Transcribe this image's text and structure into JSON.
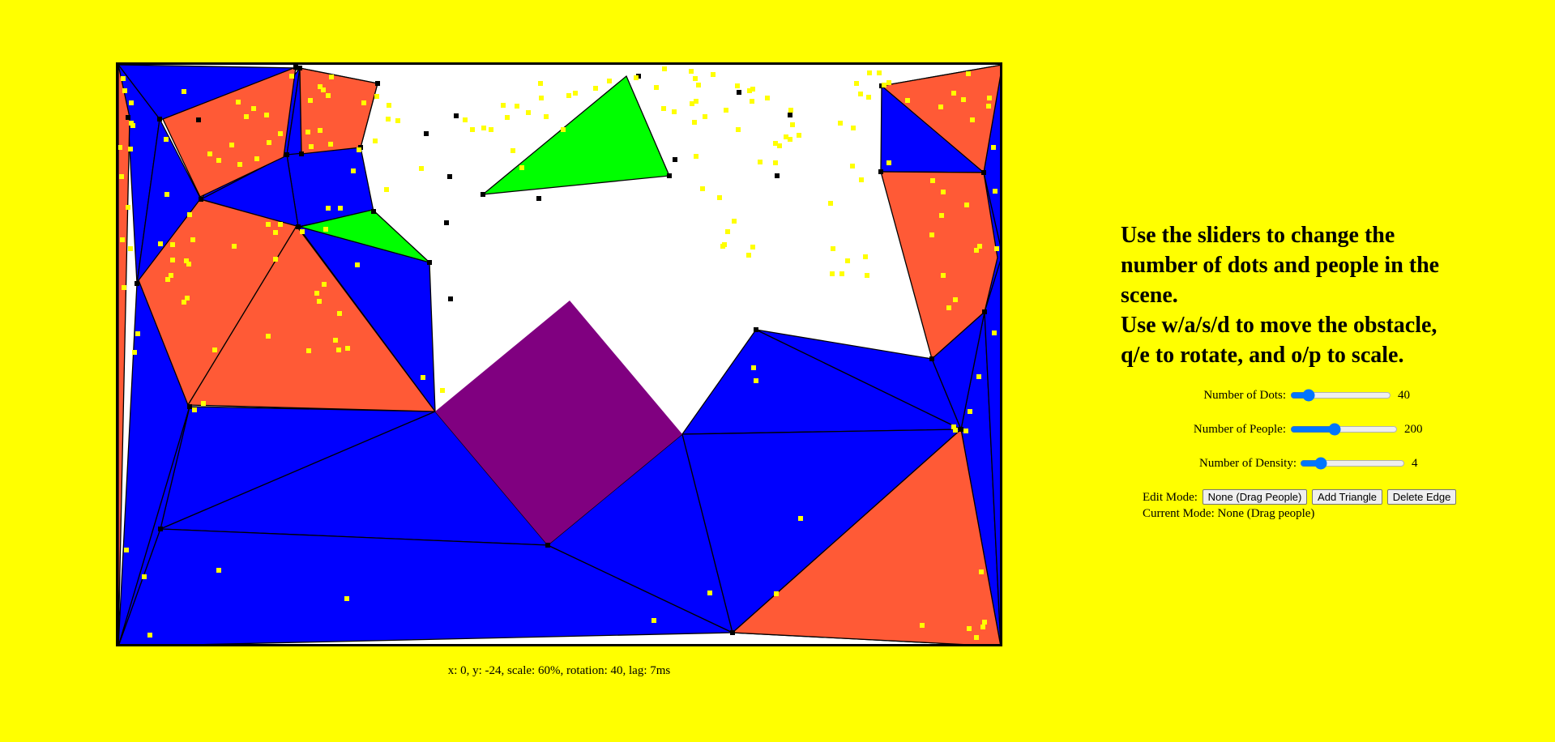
{
  "instructions": {
    "line1": "Use the sliders to change the",
    "line2": "number of dots and people in the",
    "line3": "scene.",
    "line4": "Use w/a/s/d to move the obstacle,",
    "line5": "q/e to rotate, and o/p to scale."
  },
  "sliders": {
    "dots": {
      "label": "Number of Dots:",
      "value": "40",
      "min": 0,
      "max": 300
    },
    "people": {
      "label": "Number of People:",
      "value": "200",
      "min": 0,
      "max": 500
    },
    "density": {
      "label": "Number of Density:",
      "value": "4",
      "min": 1,
      "max": 20
    }
  },
  "edit": {
    "label": "Edit Mode:",
    "buttons": [
      "None (Drag People)",
      "Add Triangle",
      "Delete Edge"
    ],
    "current_mode": "Current Mode: None (Drag people)"
  },
  "status": "x: 0, y: -24, scale: 60%, rotation: 40, lag: 7ms",
  "colors": {
    "background": "#ffff00",
    "blue_region": "#0000ff",
    "orange_region": "#ff5a36",
    "green_region": "#00ff00",
    "obstacle": "#800080",
    "person": "#ffff00",
    "vertex": "#000000"
  }
}
